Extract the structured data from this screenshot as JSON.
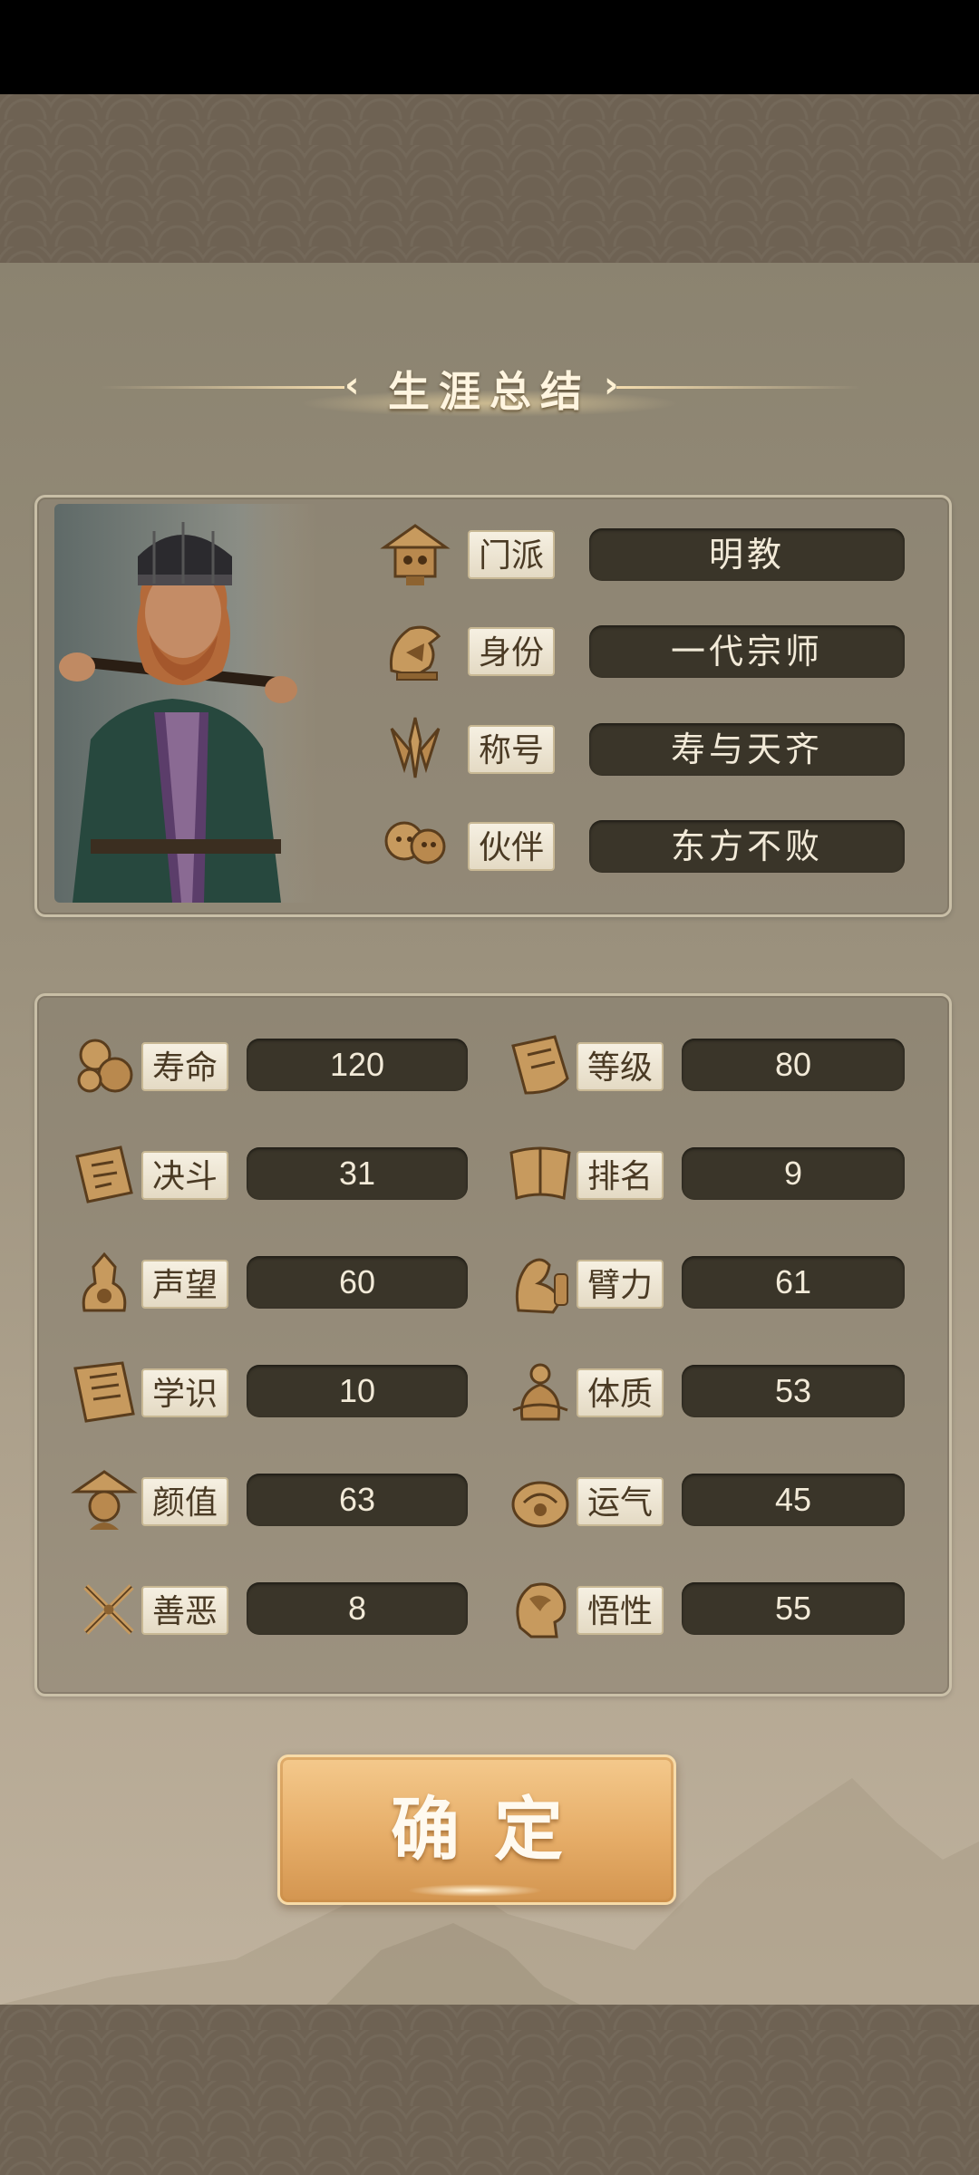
{
  "title": "生涯总结",
  "profile": {
    "rows": [
      {
        "icon": "sect-icon",
        "label": "门派",
        "value": "明教"
      },
      {
        "icon": "identity-icon",
        "label": "身份",
        "value": "一代宗师"
      },
      {
        "icon": "title-icon",
        "label": "称号",
        "value": "寿与天齐"
      },
      {
        "icon": "partner-icon",
        "label": "伙伴",
        "value": "东方不败"
      }
    ]
  },
  "stats": {
    "left": [
      {
        "icon": "lifespan-icon",
        "label": "寿命",
        "value": "120"
      },
      {
        "icon": "duel-icon",
        "label": "决斗",
        "value": "31"
      },
      {
        "icon": "reputation-icon",
        "label": "声望",
        "value": "60"
      },
      {
        "icon": "knowledge-icon",
        "label": "学识",
        "value": "10"
      },
      {
        "icon": "appearance-icon",
        "label": "颜值",
        "value": "63"
      },
      {
        "icon": "morality-icon",
        "label": "善恶",
        "value": "8"
      }
    ],
    "right": [
      {
        "icon": "level-icon",
        "label": "等级",
        "value": "80"
      },
      {
        "icon": "ranking-icon",
        "label": "排名",
        "value": "9"
      },
      {
        "icon": "arm-strength-icon",
        "label": "臂力",
        "value": "61"
      },
      {
        "icon": "constitution-icon",
        "label": "体质",
        "value": "53"
      },
      {
        "icon": "luck-icon",
        "label": "运气",
        "value": "45"
      },
      {
        "icon": "comprehension-icon",
        "label": "悟性",
        "value": "55"
      }
    ]
  },
  "confirm_label": "确定",
  "colors": {
    "accent": "#e6ad68",
    "value_bg": "#3a3529",
    "label_bg": "#f6f0e2"
  }
}
